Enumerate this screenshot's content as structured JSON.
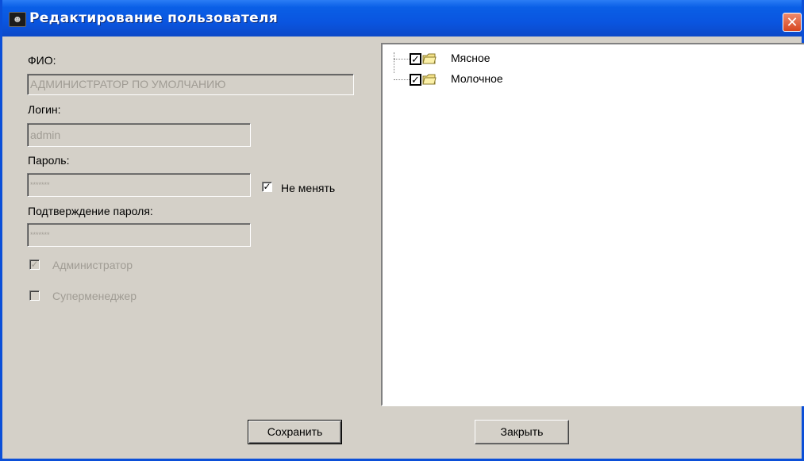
{
  "window": {
    "title": "Редактирование пользователя",
    "close_symbol": "✕"
  },
  "form": {
    "fio_label": "ФИО:",
    "fio_value": "АДМИНИСТРАТОР ПО УМОЛЧАНИЮ",
    "login_label": "Логин:",
    "login_value": "admin",
    "password_label": "Пароль:",
    "password_value": "*******",
    "no_change_label": "Не менять",
    "no_change_checked": true,
    "confirm_label": "Подтверждение пароля:",
    "confirm_value": "*******",
    "admin_label": "Администратор",
    "admin_checked": true,
    "supermanager_label": "Суперменеджер",
    "supermanager_checked": false
  },
  "tree": {
    "items": [
      {
        "label": "Мясное",
        "checked": true
      },
      {
        "label": "Молочное",
        "checked": true
      }
    ]
  },
  "buttons": {
    "save_label": "Сохранить",
    "close_label": "Закрыть"
  },
  "colors": {
    "titlebar": "#0a55e0",
    "face": "#d4d0c8",
    "disabled_text": "#a09c94"
  }
}
